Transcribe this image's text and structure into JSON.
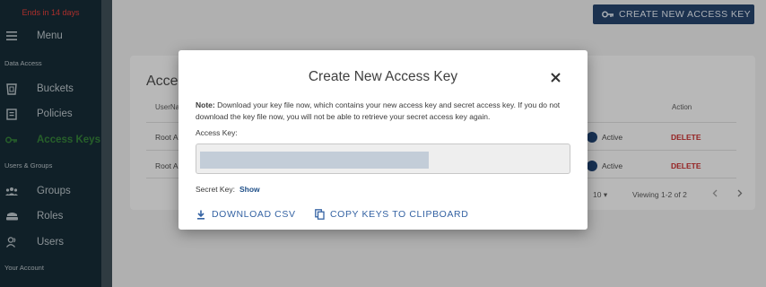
{
  "sidebar": {
    "trial_text": "Ends in 14 days",
    "menu_label": "Menu",
    "section_data_access": "Data Access",
    "items": [
      {
        "label": "Buckets",
        "icon": "bucket-icon"
      },
      {
        "label": "Policies",
        "icon": "policy-icon"
      },
      {
        "label": "Access Keys",
        "icon": "key-icon",
        "active": true
      },
      {
        "label": "Groups",
        "icon": "groups-icon"
      },
      {
        "label": "Roles",
        "icon": "roles-icon"
      },
      {
        "label": "Users",
        "icon": "users-icon"
      }
    ],
    "section_users_groups": "Users & Groups",
    "section_account": "Your Account",
    "active_color": "#2e7d32"
  },
  "header": {
    "create_button_label": "CREATE NEW ACCESS KEY"
  },
  "table": {
    "title": "Acce",
    "col_user": "UserNa",
    "col_action": "Action",
    "rows": [
      {
        "user": "Root A",
        "status": "Active",
        "action": "DELETE"
      },
      {
        "user": "Root A",
        "status": "Active",
        "action": "DELETE"
      }
    ],
    "rows_per_page": "10 ▾",
    "viewing": "Viewing 1-2 of 2"
  },
  "modal": {
    "title": "Create New Access Key",
    "note_bold": "Note:",
    "note_text": " Download your key file now, which contains your new access key and secret access key. If you do not download the key file now, you will not be able to retrieve your secret access key again.",
    "access_key_label": "Access Key:",
    "secret_key_label": "Secret Key:",
    "show_label": "Show",
    "download_label": "DOWNLOAD CSV",
    "copy_label": "COPY KEYS TO CLIPBOARD"
  }
}
